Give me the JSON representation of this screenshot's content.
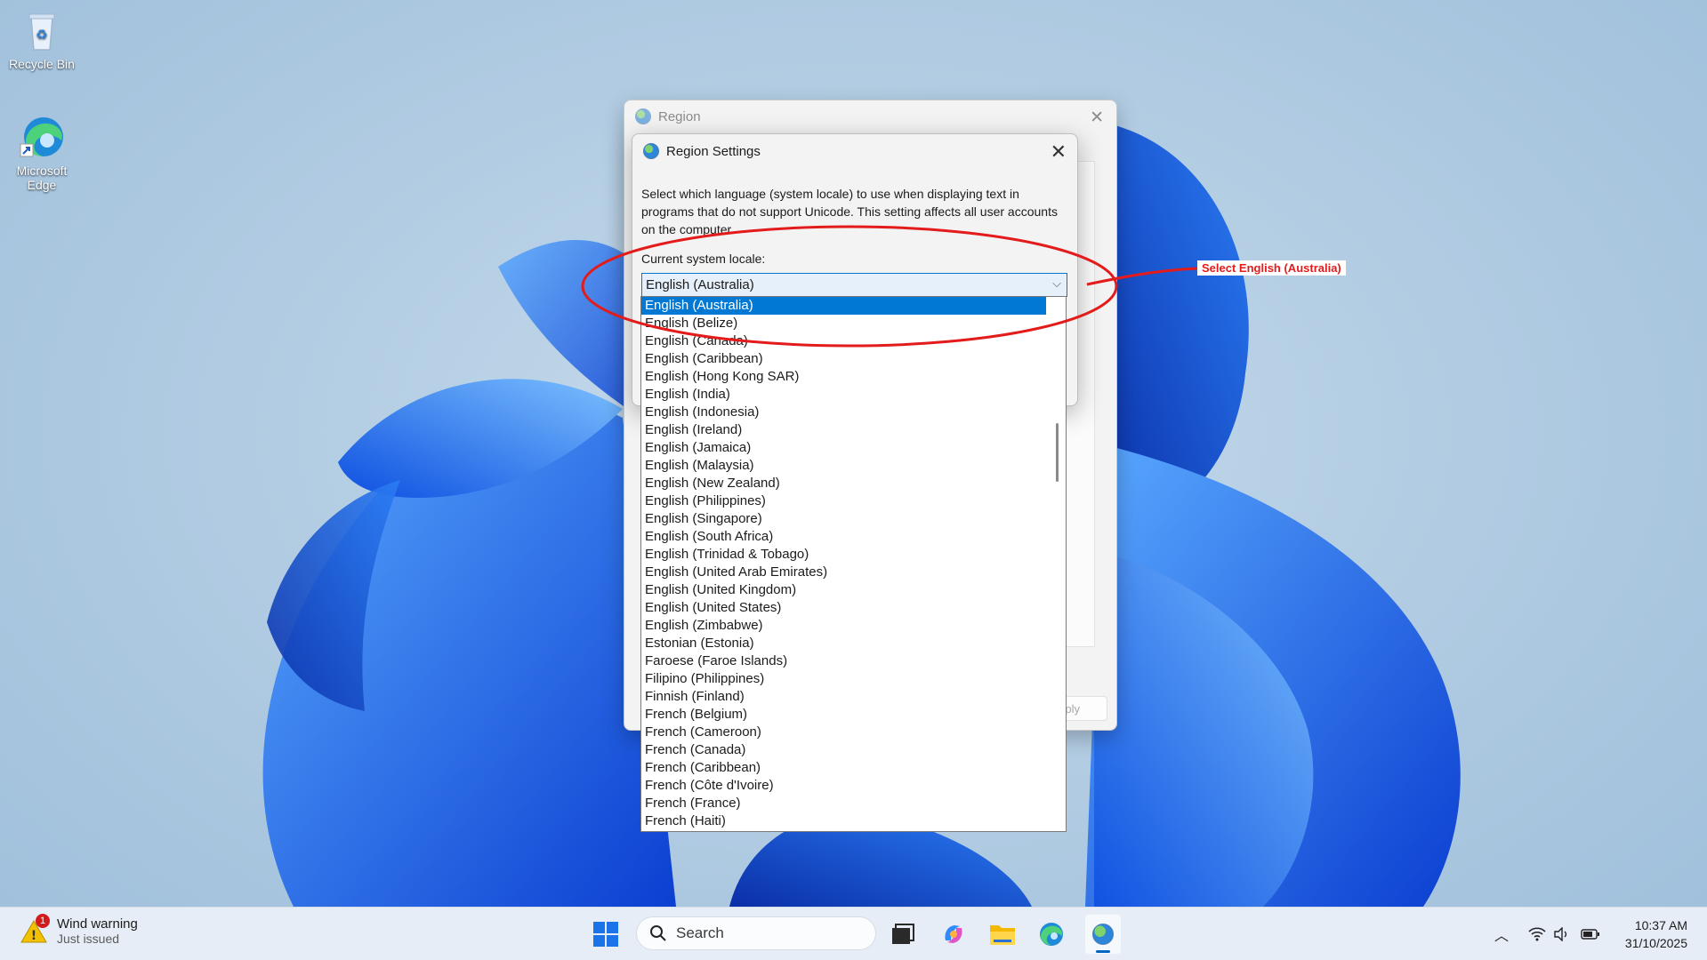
{
  "desktop": {
    "icons": [
      {
        "label": "Recycle Bin"
      },
      {
        "label": "Microsoft Edge"
      }
    ]
  },
  "region_window": {
    "title": "Region",
    "apply_label": "Apply"
  },
  "settings_dialog": {
    "title": "Region Settings",
    "description": "Select which language (system locale) to use when displaying text in programs that do not support Unicode. This setting affects all user accounts on the computer.",
    "locale_label": "Current system locale:",
    "locale_value": "English (Australia)",
    "locale_options": [
      "English (Australia)",
      "English (Belize)",
      "English (Canada)",
      "English (Caribbean)",
      "English (Hong Kong SAR)",
      "English (India)",
      "English (Indonesia)",
      "English (Ireland)",
      "English (Jamaica)",
      "English (Malaysia)",
      "English (New Zealand)",
      "English (Philippines)",
      "English (Singapore)",
      "English (South Africa)",
      "English (Trinidad & Tobago)",
      "English (United Arab Emirates)",
      "English (United Kingdom)",
      "English (United States)",
      "English (Zimbabwe)",
      "Estonian (Estonia)",
      "Faroese (Faroe Islands)",
      "Filipino (Philippines)",
      "Finnish (Finland)",
      "French (Belgium)",
      "French (Cameroon)",
      "French (Canada)",
      "French (Caribbean)",
      "French (Côte d'Ivoire)",
      "French (France)",
      "French (Haiti)"
    ],
    "selected_index": 0
  },
  "annotation": {
    "callout_text": "Select English (Australia)",
    "color": "#e31b1b"
  },
  "taskbar": {
    "weather_title": "Wind warning",
    "weather_subtitle": "Just issued",
    "weather_badge": "1",
    "search_placeholder": "Search",
    "time": "10:37 AM",
    "date": "31/10/2025"
  },
  "colors": {
    "accent": "#0078d4",
    "taskbar": "#e6edf6"
  }
}
